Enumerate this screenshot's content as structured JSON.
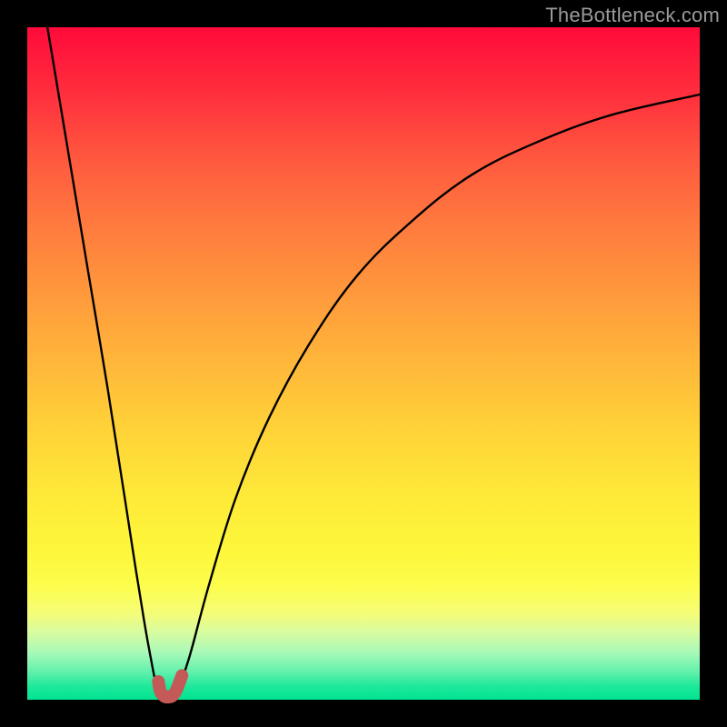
{
  "watermark": "TheBottleneck.com",
  "chart_data": {
    "type": "line",
    "title": "",
    "xlabel": "",
    "ylabel": "",
    "xlim": [
      0,
      100
    ],
    "ylim": [
      0,
      100
    ],
    "series": [
      {
        "name": "left-curve",
        "x": [
          3,
          6,
          9,
          12,
          14.5,
          16.2,
          17.5,
          18.4,
          19.0,
          19.5,
          20.2,
          21.0,
          22.0
        ],
        "y": [
          100,
          82,
          64,
          46,
          30,
          19,
          11,
          6,
          3,
          1.5,
          0.5,
          0.2,
          0.5
        ]
      },
      {
        "name": "right-curve",
        "x": [
          22,
          24,
          27,
          31,
          36,
          42,
          49,
          57,
          66,
          76,
          87,
          100
        ],
        "y": [
          0.5,
          6,
          17,
          30,
          42,
          53,
          63,
          71,
          78,
          83,
          87,
          90
        ]
      },
      {
        "name": "marker-hook",
        "x": [
          19.5,
          19.8,
          20.4,
          21.0,
          21.6,
          22.2,
          23.0
        ],
        "y": [
          2.7,
          1.2,
          0.5,
          0.4,
          0.6,
          1.5,
          3.6
        ]
      }
    ],
    "colors": {
      "curve": "#000000",
      "marker": "#c35a58"
    }
  }
}
